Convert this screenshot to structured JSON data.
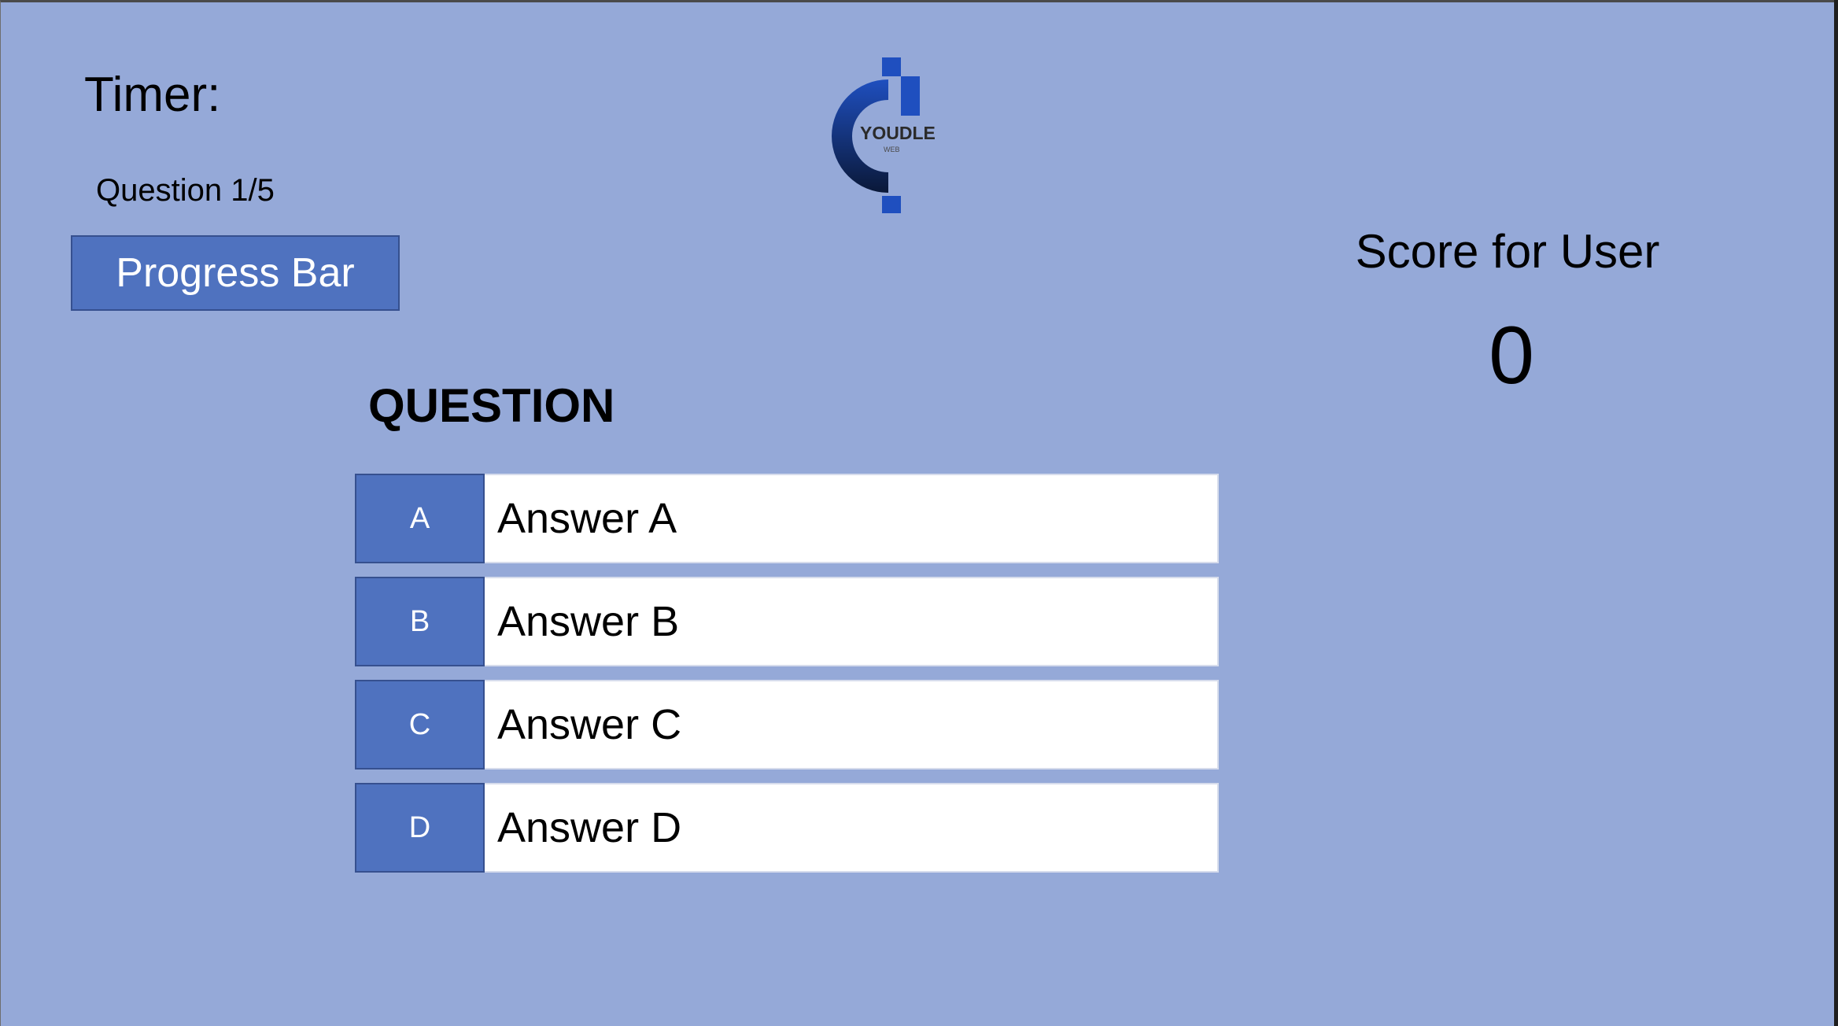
{
  "header": {
    "timer_label": "Timer:",
    "question_counter": "Question 1/5",
    "progress_bar_label": "Progress Bar"
  },
  "logo": {
    "name": "YOUDLE",
    "sub": "WEB",
    "icon": "youdle-web-logo"
  },
  "score": {
    "label": "Score for User",
    "value": "0"
  },
  "question": {
    "title": "QUESTION"
  },
  "answers": [
    {
      "letter": "A",
      "text": "Answer A"
    },
    {
      "letter": "B",
      "text": "Answer B"
    },
    {
      "letter": "C",
      "text": "Answer C"
    },
    {
      "letter": "D",
      "text": "Answer D"
    }
  ],
  "colors": {
    "background": "#95a9d8",
    "accent": "#4f72bf",
    "answer_box": "#ffffff",
    "logo_dark": "#0d1f4f",
    "logo_blue": "#1f4fbf"
  }
}
